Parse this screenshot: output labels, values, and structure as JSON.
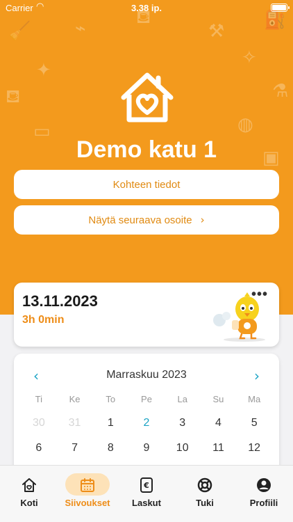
{
  "status": {
    "carrier": "Carrier",
    "time": "3.38 ip."
  },
  "property": {
    "address": "Demo katu 1"
  },
  "buttons": {
    "details": "Kohteen tiedot",
    "next_address": "Näytä seuraava osoite"
  },
  "visit": {
    "date": "13.11.2023",
    "duration": "3h 0min",
    "more": "•••"
  },
  "calendar": {
    "month": "Marraskuu 2023",
    "weekdays": [
      "Ti",
      "Ke",
      "To",
      "Pe",
      "La",
      "Su",
      "Ma"
    ],
    "row1": [
      "30",
      "31",
      "1",
      "2",
      "3",
      "4",
      "5"
    ],
    "row2": [
      "6",
      "7",
      "8",
      "9",
      "10",
      "11",
      "12"
    ]
  },
  "tabs": [
    "Koti",
    "Siivoukset",
    "Laskut",
    "Tuki",
    "Profiili"
  ],
  "colors": {
    "brand": "#f39a1d",
    "accent_text": "#ee8d18",
    "link": "#1aa3c4"
  }
}
